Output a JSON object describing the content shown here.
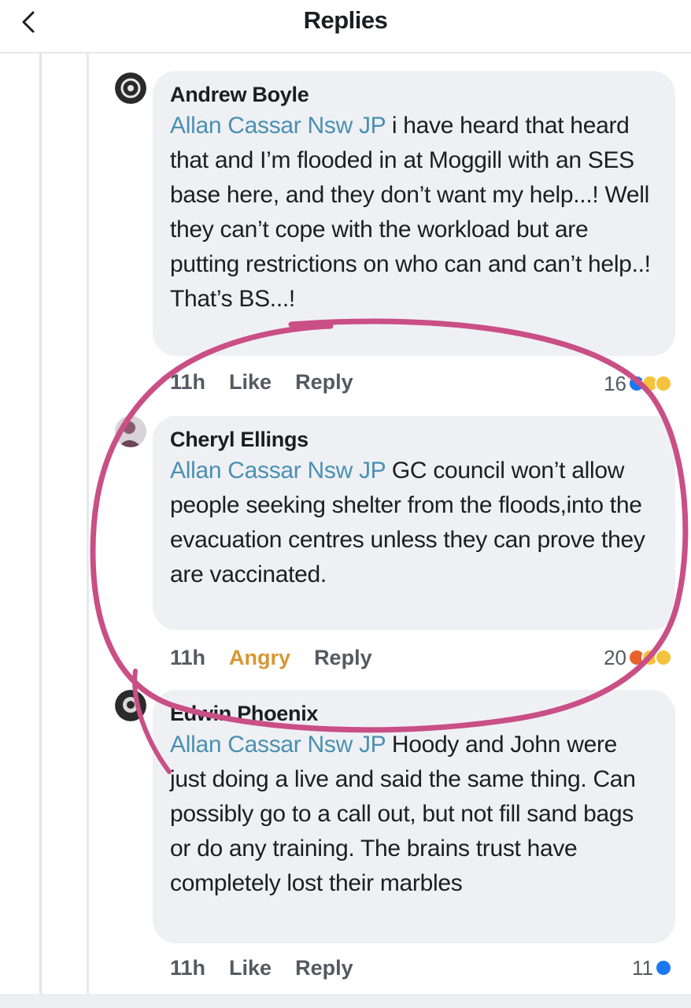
{
  "header": {
    "title": "Replies"
  },
  "comments": [
    {
      "author": "Andrew Boyle",
      "mention": "Allan Cassar Nsw JP",
      "text": " i have heard that heard that and I’m flooded in at Moggill with an SES base here, and they don’t want my help...! Well they can’t cope with the workload but are putting restrictions on who can and can’t help..! That’s BS...!",
      "time": "11h",
      "action1": "Like",
      "action2": "Reply",
      "reaction_count": "16"
    },
    {
      "author": "Cheryl Ellings",
      "mention": "Allan Cassar Nsw JP",
      "text": "  GC council won’t allow  people seeking shelter from the floods,into the evacuation centres unless they can prove they are vaccinated.",
      "time": "11h",
      "action1": "Angry",
      "action2": "Reply",
      "reaction_count": "20"
    },
    {
      "author": "Edwin Phoenix",
      "mention": "Allan Cassar Nsw JP",
      "text": " Hoody and John were just doing a live and said the same thing. Can possibly go to a call out, but not fill sand bags or do any training. The brains trust have completely lost their marbles",
      "time": "11h",
      "action1": "Like",
      "action2": "Reply",
      "reaction_count": "11"
    }
  ],
  "colors": {
    "mention": "#4a90b2",
    "bubble": "#eff0f4",
    "annotation": "#c94f86",
    "angry_label": "#d79735",
    "like_reaction": "#1b78f2"
  },
  "icons": {
    "back": "chevron-left-icon",
    "reactions": [
      "like-reaction-icon",
      "wow-reaction-icon",
      "angry-reaction-icon"
    ]
  }
}
